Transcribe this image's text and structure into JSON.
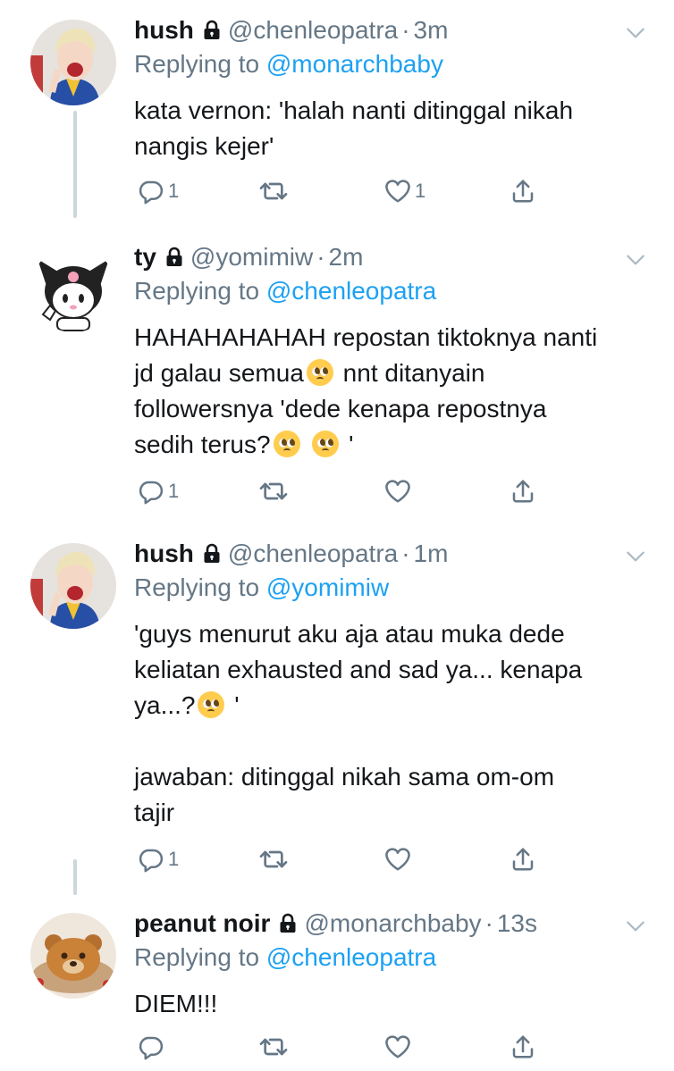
{
  "tweets": [
    {
      "name": "hush",
      "handle": "@chenleopatra",
      "time": "3m",
      "reply_prefix": "Replying to",
      "reply_to": "@monarchbaby",
      "text": "kata vernon: 'halah nanti ditinggal nikah\nnangis kejer'",
      "reply_count": "1",
      "like_count": "1"
    },
    {
      "name": "ty",
      "handle": "@yomimiw",
      "time": "2m",
      "reply_prefix": "Replying to",
      "reply_to": "@chenleopatra",
      "text_parts": [
        "HAHAHAHAHAH repostan tiktoknya nanti\njd galau semua",
        " nnt ditanyain\nfollowersnya 'dede kenapa repostnya\nsedih terus?",
        " ",
        " '"
      ],
      "reply_count": "1",
      "like_count": ""
    },
    {
      "name": "hush",
      "handle": "@chenleopatra",
      "time": "1m",
      "reply_prefix": "Replying to",
      "reply_to": "@yomimiw",
      "text_parts": [
        "'guys menurut aku aja atau muka dede\nkeliatan exhausted and sad ya... kenapa\nya...?",
        " '\n\njawaban: ditinggal nikah sama om-om\ntajir"
      ],
      "reply_count": "1",
      "like_count": ""
    },
    {
      "name": "peanut noir",
      "handle": "@monarchbaby",
      "time": "13s",
      "reply_prefix": "Replying to",
      "reply_to": "@chenleopatra",
      "text": "DIEM!!!",
      "reply_count": "",
      "like_count": ""
    }
  ],
  "dot": "·",
  "icons": {
    "lock": "lock-icon",
    "chevron": "chevron-down-icon",
    "reply": "reply-icon",
    "retweet": "retweet-icon",
    "like": "heart-icon",
    "share": "share-icon",
    "emoji": "pleading-face-emoji"
  },
  "colors": {
    "link": "#1da1f2",
    "secondary": "#657786",
    "thread_line": "#ccd6dd"
  }
}
